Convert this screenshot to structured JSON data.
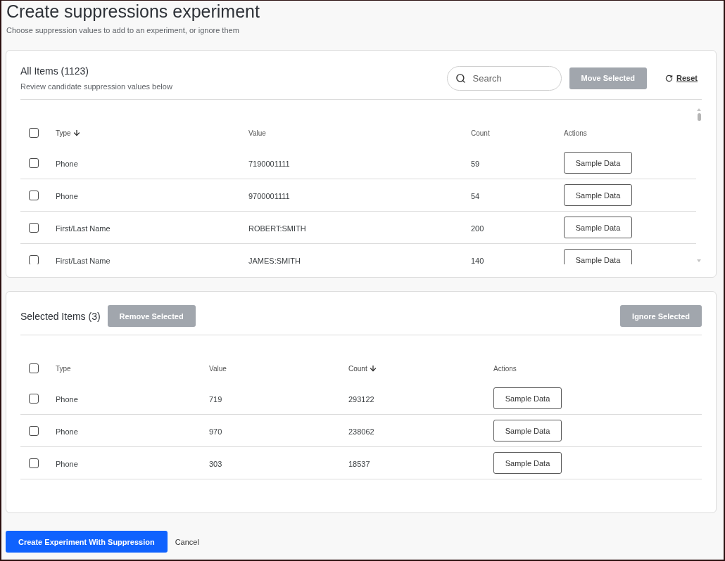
{
  "page": {
    "title": "Create suppressions experiment",
    "subtitle": "Choose suppression values to add to an experiment, or ignore them"
  },
  "all_items": {
    "title": "All Items (1123)",
    "subtitle": "Review candidate suppression values below",
    "search": {
      "placeholder": "Search"
    },
    "move_button": {
      "label": "Move Selected",
      "disabled": true
    },
    "reset_link": {
      "label": "Reset"
    },
    "select_all": {
      "checked": false
    },
    "columns": [
      {
        "label": "Type",
        "sorted": true
      },
      {
        "label": "Value",
        "sorted": false
      },
      {
        "label": "Count",
        "sorted": false
      },
      {
        "label": "Actions",
        "sorted": false
      }
    ],
    "rows": [
      {
        "checked": false,
        "cells": [
          "Phone",
          "7190001111",
          "59"
        ],
        "action": "Sample Data"
      },
      {
        "checked": false,
        "cells": [
          "Phone",
          "9700001111",
          "54"
        ],
        "action": "Sample Data"
      },
      {
        "checked": false,
        "cells": [
          "First/Last Name",
          "ROBERT:SMITH",
          "200"
        ],
        "action": "Sample Data"
      },
      {
        "checked": false,
        "cells": [
          "First/Last Name",
          "JAMES:SMITH",
          "140"
        ],
        "action": "Sample Data"
      }
    ]
  },
  "selected_items": {
    "title": "Selected Items (3)",
    "remove_button": {
      "label": "Remove Selected",
      "disabled": true
    },
    "ignore_button": {
      "label": "Ignore Selected",
      "disabled": true
    },
    "select_all": {
      "checked": false
    },
    "columns": [
      {
        "label": "Type",
        "sorted": false
      },
      {
        "label": "Value",
        "sorted": false
      },
      {
        "label": "Count",
        "sorted": true
      },
      {
        "label": "Actions",
        "sorted": false
      }
    ],
    "rows": [
      {
        "checked": false,
        "cells": [
          "Phone",
          "719",
          "293122"
        ],
        "action": "Sample Data"
      },
      {
        "checked": false,
        "cells": [
          "Phone",
          "970",
          "238062"
        ],
        "action": "Sample Data"
      },
      {
        "checked": false,
        "cells": [
          "Phone",
          "303",
          "18537"
        ],
        "action": "Sample Data"
      }
    ]
  },
  "footer": {
    "create_button": "Create Experiment With Suppression",
    "cancel_link": "Cancel"
  }
}
